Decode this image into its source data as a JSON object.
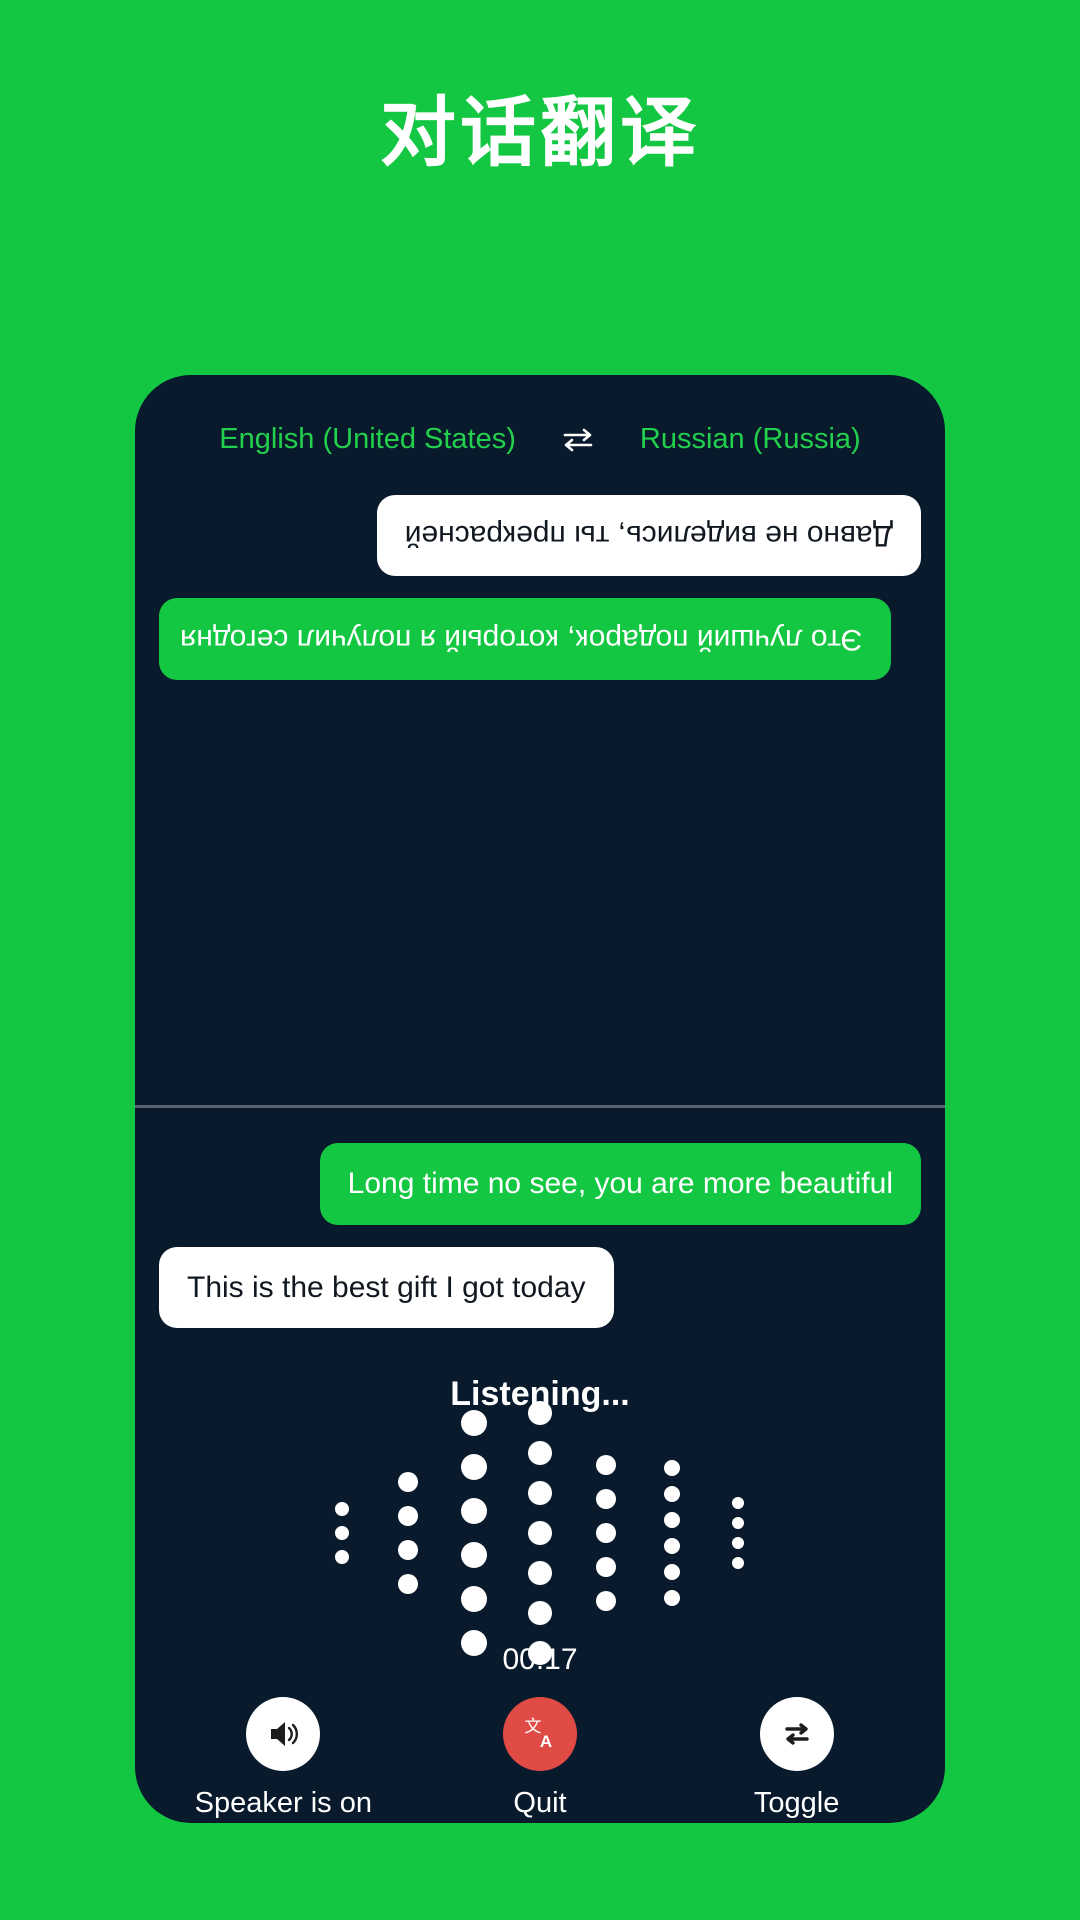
{
  "header": {
    "title": "对话翻译"
  },
  "colors": {
    "brand_green": "#14c742",
    "card_dark": "#081a2b",
    "accent_red": "#e04b45",
    "lang_text_green": "#22d04d"
  },
  "language_bar": {
    "source_language": "English (United States)",
    "swap_icon": "swap-horizontal-icon",
    "target_language": "Russian (Russia)"
  },
  "conversation": {
    "remote_panel": {
      "rotated": true,
      "messages": [
        {
          "text": "Это лучший подарок, который я получил сегодня",
          "align": "right",
          "style": "green"
        },
        {
          "text": "Давно не виделись, ты прекрасней",
          "align": "left",
          "style": "white"
        }
      ]
    },
    "local_panel": {
      "rotated": false,
      "messages": [
        {
          "text": "Long time no see, you are more beautiful",
          "align": "right",
          "style": "green"
        },
        {
          "text": "This is the best gift I got today",
          "align": "left",
          "style": "white"
        }
      ]
    }
  },
  "status": {
    "listening_label": "Listening...",
    "timer": "00:17"
  },
  "waveform": {
    "columns": [
      {
        "dots": 3,
        "size": 14
      },
      {
        "dots": 4,
        "size": 20
      },
      {
        "dots": 6,
        "size": 26
      },
      {
        "dots": 7,
        "size": 24
      },
      {
        "dots": 5,
        "size": 20
      },
      {
        "dots": 6,
        "size": 16
      },
      {
        "dots": 4,
        "size": 12
      }
    ]
  },
  "controls": [
    {
      "label": "Speaker is on",
      "icon": "speaker-on-icon",
      "circle": "white"
    },
    {
      "label": "Quit",
      "icon": "translate-icon",
      "circle": "red"
    },
    {
      "label": "Toggle",
      "icon": "repeat-swap-icon",
      "circle": "white"
    }
  ]
}
